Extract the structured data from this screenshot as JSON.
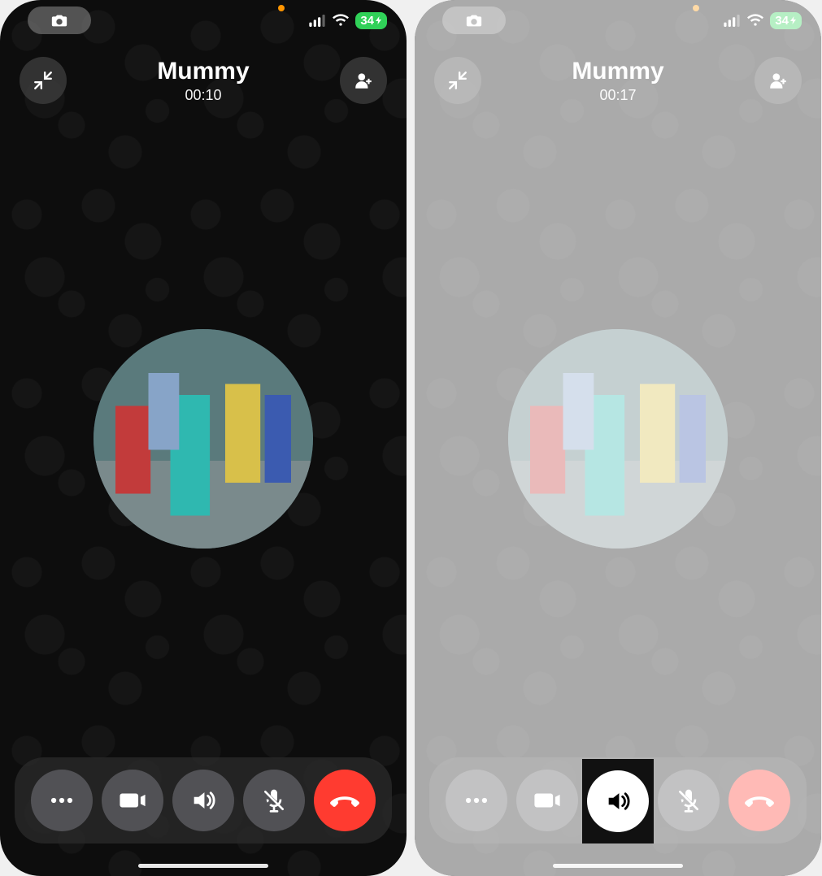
{
  "left": {
    "status": {
      "battery": "34",
      "charging": "⚡"
    },
    "contact_name": "Mummy",
    "timer": "00:10",
    "controls": {
      "more": "more",
      "video": "video",
      "speaker": "speaker",
      "mute": "mute",
      "end": "end"
    }
  },
  "right": {
    "status": {
      "battery": "34",
      "charging": "⚡"
    },
    "contact_name": "Mummy",
    "timer": "00:17",
    "controls": {
      "more": "more",
      "video": "video",
      "speaker": "speaker",
      "mute": "mute",
      "end": "end"
    }
  }
}
